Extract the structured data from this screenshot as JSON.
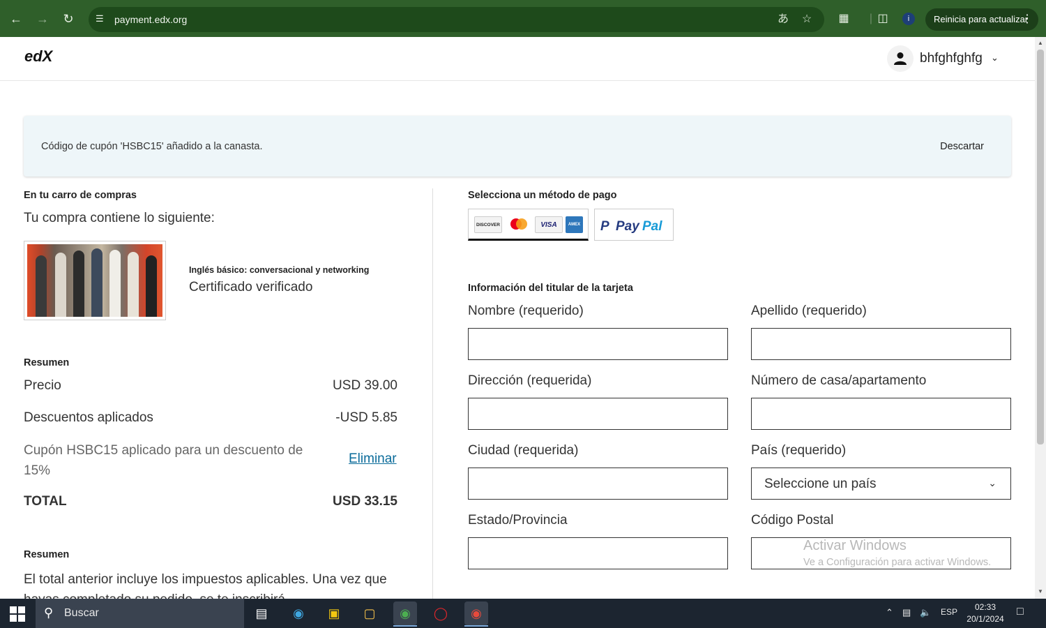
{
  "browser": {
    "url": "payment.edx.org",
    "update_label": "Reinicia para actualizar",
    "profile_initial": "i"
  },
  "header": {
    "logo_text": "edX",
    "username": "bhfghfghfg"
  },
  "alert": {
    "message": "Código de cupón 'HSBC15' añadido a la canasta.",
    "dismiss_label": "Descartar"
  },
  "cart": {
    "heading": "En tu carro de compras",
    "intro": "Tu compra contiene lo siguiente:",
    "item_title": "Inglés básico: conversacional y networking",
    "item_type": "Certificado verificado"
  },
  "summary": {
    "heading": "Resumen",
    "price_label": "Precio",
    "price_value": "USD 39.00",
    "discount_label": "Descuentos aplicados",
    "discount_value": "-USD 5.85",
    "coupon_text": "Cupón HSBC15 aplicado para un descuento de 15%",
    "remove_label": "Eliminar",
    "total_label": "TOTAL",
    "total_value": "USD 33.15"
  },
  "summary2": {
    "heading": "Resumen",
    "text": "El total anterior incluye los impuestos aplicables. Una vez que hayas completado su pedido, se te inscribirá"
  },
  "payment": {
    "heading": "Selecciona un método de pago",
    "card_brands": [
      "DISCOVER",
      "mastercard",
      "VISA",
      "AMEX"
    ],
    "paypal_label": "PayPal"
  },
  "form": {
    "heading": "Información del titular de la tarjeta",
    "first_name_label": "Nombre (requerido)",
    "last_name_label": "Apellido (requerido)",
    "address_label": "Dirección (requerida)",
    "unit_label": "Número de casa/apartamento",
    "city_label": "Ciudad (requerida)",
    "country_label": "País (requerido)",
    "country_value": "Seleccione un país",
    "state_label": "Estado/Provincia",
    "postal_label": "Código Postal"
  },
  "watermark": {
    "line1": "Activar Windows",
    "line2": "Ve a Configuración para activar Windows."
  },
  "taskbar": {
    "search_label": "Buscar",
    "lang": "ESP",
    "time": "02:33",
    "date": "20/1/2024"
  },
  "colors": {
    "browser_frame": "#2f5f2a",
    "alert_bg": "#eef6f9",
    "link": "#0a6b9a",
    "taskbar": "#1c2530"
  }
}
